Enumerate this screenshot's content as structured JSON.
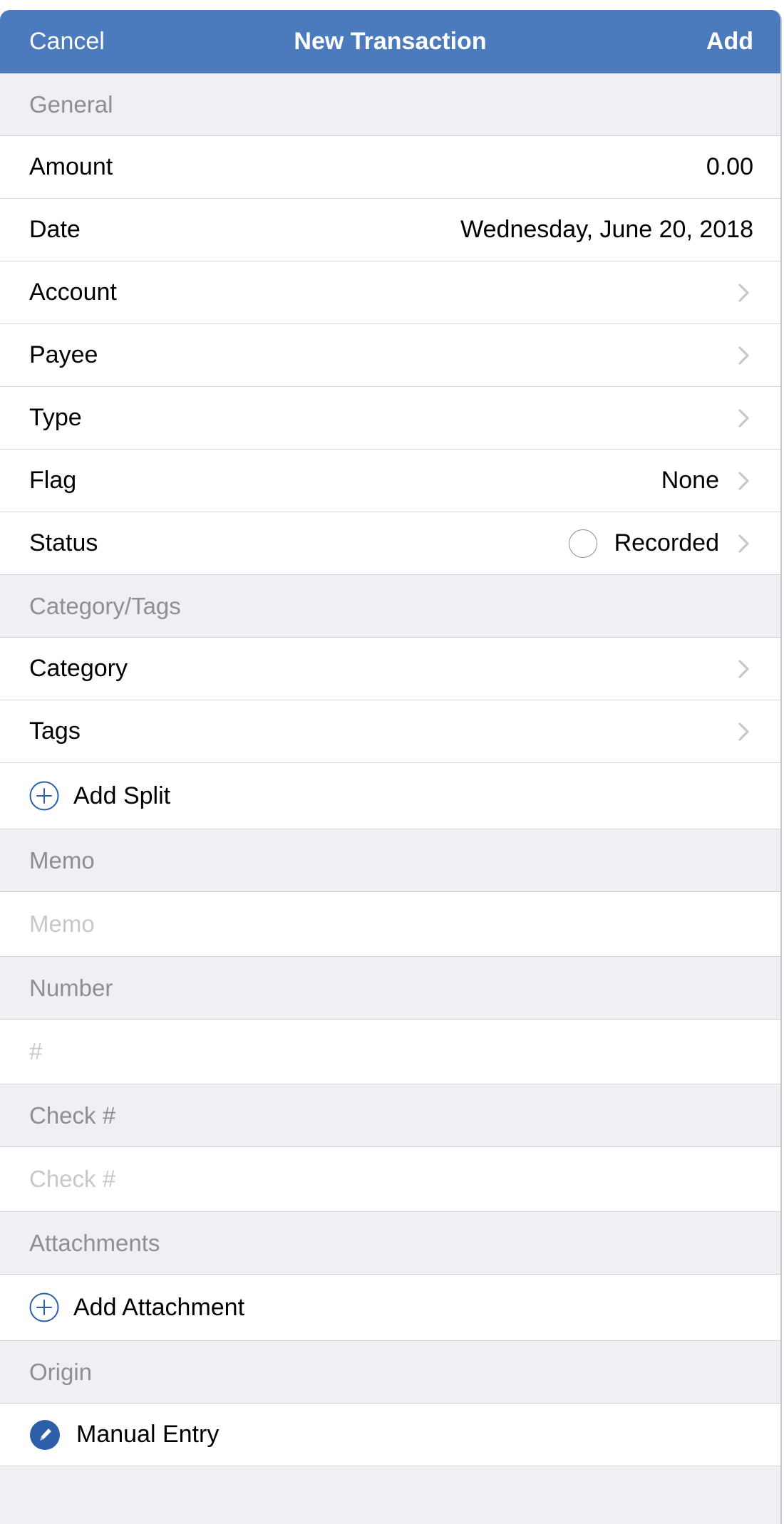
{
  "nav": {
    "cancel_label": "Cancel",
    "title": "New Transaction",
    "add_label": "Add",
    "background": "#4c7bbd"
  },
  "general": {
    "header": "General",
    "amount_label": "Amount",
    "amount_value": "0.00",
    "date_label": "Date",
    "date_value": "Wednesday, June 20, 2018",
    "account_label": "Account",
    "payee_label": "Payee",
    "type_label": "Type",
    "flag_label": "Flag",
    "flag_value": "None",
    "status_label": "Status",
    "status_value": "Recorded"
  },
  "category_tags": {
    "header": "Category/Tags",
    "category_label": "Category",
    "tags_label": "Tags",
    "add_split_label": "Add Split"
  },
  "memo": {
    "header": "Memo",
    "placeholder": "Memo"
  },
  "number": {
    "header": "Number",
    "placeholder": "#"
  },
  "check": {
    "header": "Check #",
    "placeholder": "Check #"
  },
  "attachments": {
    "header": "Attachments",
    "add_attachment_label": "Add Attachment"
  },
  "origin": {
    "header": "Origin",
    "value": "Manual Entry"
  },
  "icons": {
    "chevron": "chevron-right-icon",
    "plus": "plus-circle-icon",
    "pencil": "pencil-circle-icon",
    "status": "empty-circle-icon"
  },
  "colors": {
    "accent": "#2b5fa8",
    "header_text": "#8e8e93",
    "placeholder": "#c7c7cc",
    "background": "#efeff4"
  }
}
